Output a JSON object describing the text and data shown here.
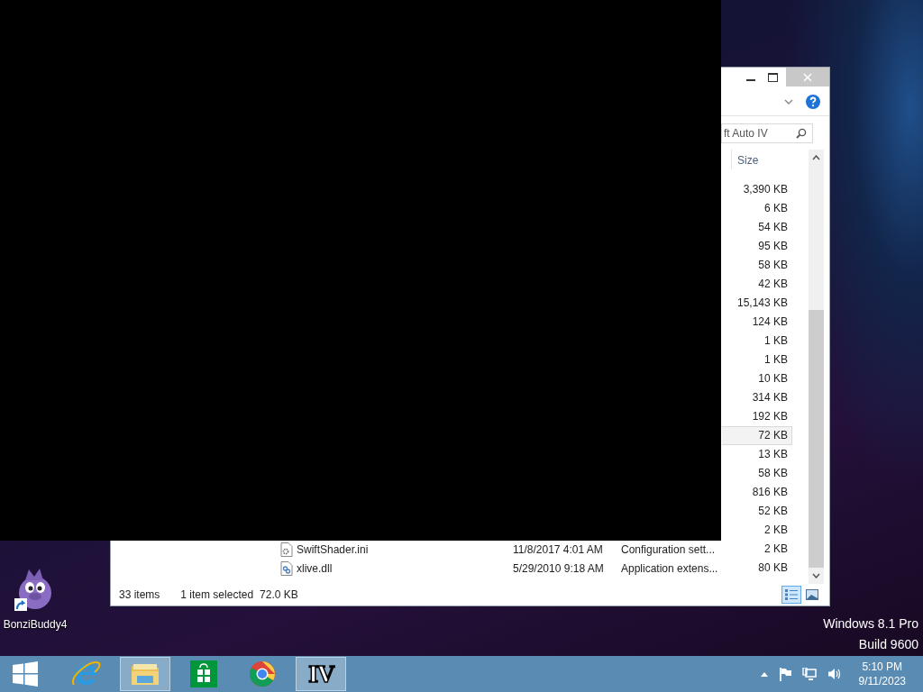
{
  "desktop": {
    "icons": [
      {
        "label": "BonziBuddy4",
        "shortcut": true
      }
    ],
    "os_edition": [
      "Windows 8.1 Pro",
      "Build 9600"
    ]
  },
  "explorer": {
    "search": {
      "value": "ft Auto IV"
    },
    "columns": [
      {
        "label": "Size"
      }
    ],
    "rows": [
      {
        "size": "3,390 KB",
        "selected": false
      },
      {
        "size": "6 KB",
        "selected": false
      },
      {
        "size": "54 KB",
        "selected": false
      },
      {
        "size": "95 KB",
        "selected": false
      },
      {
        "size": "58 KB",
        "selected": false
      },
      {
        "size": "42 KB",
        "selected": false
      },
      {
        "size": "15,143 KB",
        "selected": false
      },
      {
        "size": "124 KB",
        "selected": false
      },
      {
        "size": "1 KB",
        "selected": false
      },
      {
        "size": "1 KB",
        "selected": false
      },
      {
        "size": "10 KB",
        "selected": false
      },
      {
        "size": "314 KB",
        "selected": false
      },
      {
        "size": "192 KB",
        "selected": false
      },
      {
        "size": "72 KB",
        "selected": true
      },
      {
        "size": "13 KB",
        "selected": false
      },
      {
        "size": "58 KB",
        "selected": false
      },
      {
        "size": "816 KB",
        "selected": false
      },
      {
        "size": "52 KB",
        "selected": false
      },
      {
        "size": "2 KB",
        "selected": false
      },
      {
        "kind": "settings-file",
        "name": "SwiftShader.ini",
        "date": "11/8/2017 4:01 AM",
        "type": "Configuration sett...",
        "size": "2 KB",
        "selected": false
      },
      {
        "kind": "library-file",
        "name": "xlive.dll",
        "date": "5/29/2010 9:18 AM",
        "type": "Application extens...",
        "size": "80 KB",
        "selected": false
      }
    ],
    "status": {
      "count": "33 items",
      "selection": "1 item selected",
      "selection_size": "72.0 KB"
    },
    "view_buttons": [
      {
        "kind": "details",
        "selected": true
      },
      {
        "kind": "large-icons",
        "selected": false
      }
    ]
  },
  "taskbar": {
    "items": [
      {
        "kind": "start",
        "active": false
      },
      {
        "kind": "browser-e",
        "active": false
      },
      {
        "kind": "folder",
        "active": true
      },
      {
        "kind": "store",
        "active": false
      },
      {
        "kind": "browser-ring",
        "active": false
      },
      {
        "kind": "logo-text",
        "label": "IV",
        "active": true
      }
    ],
    "clock": {
      "time": "5:10 PM",
      "date": "9/11/2023"
    }
  }
}
